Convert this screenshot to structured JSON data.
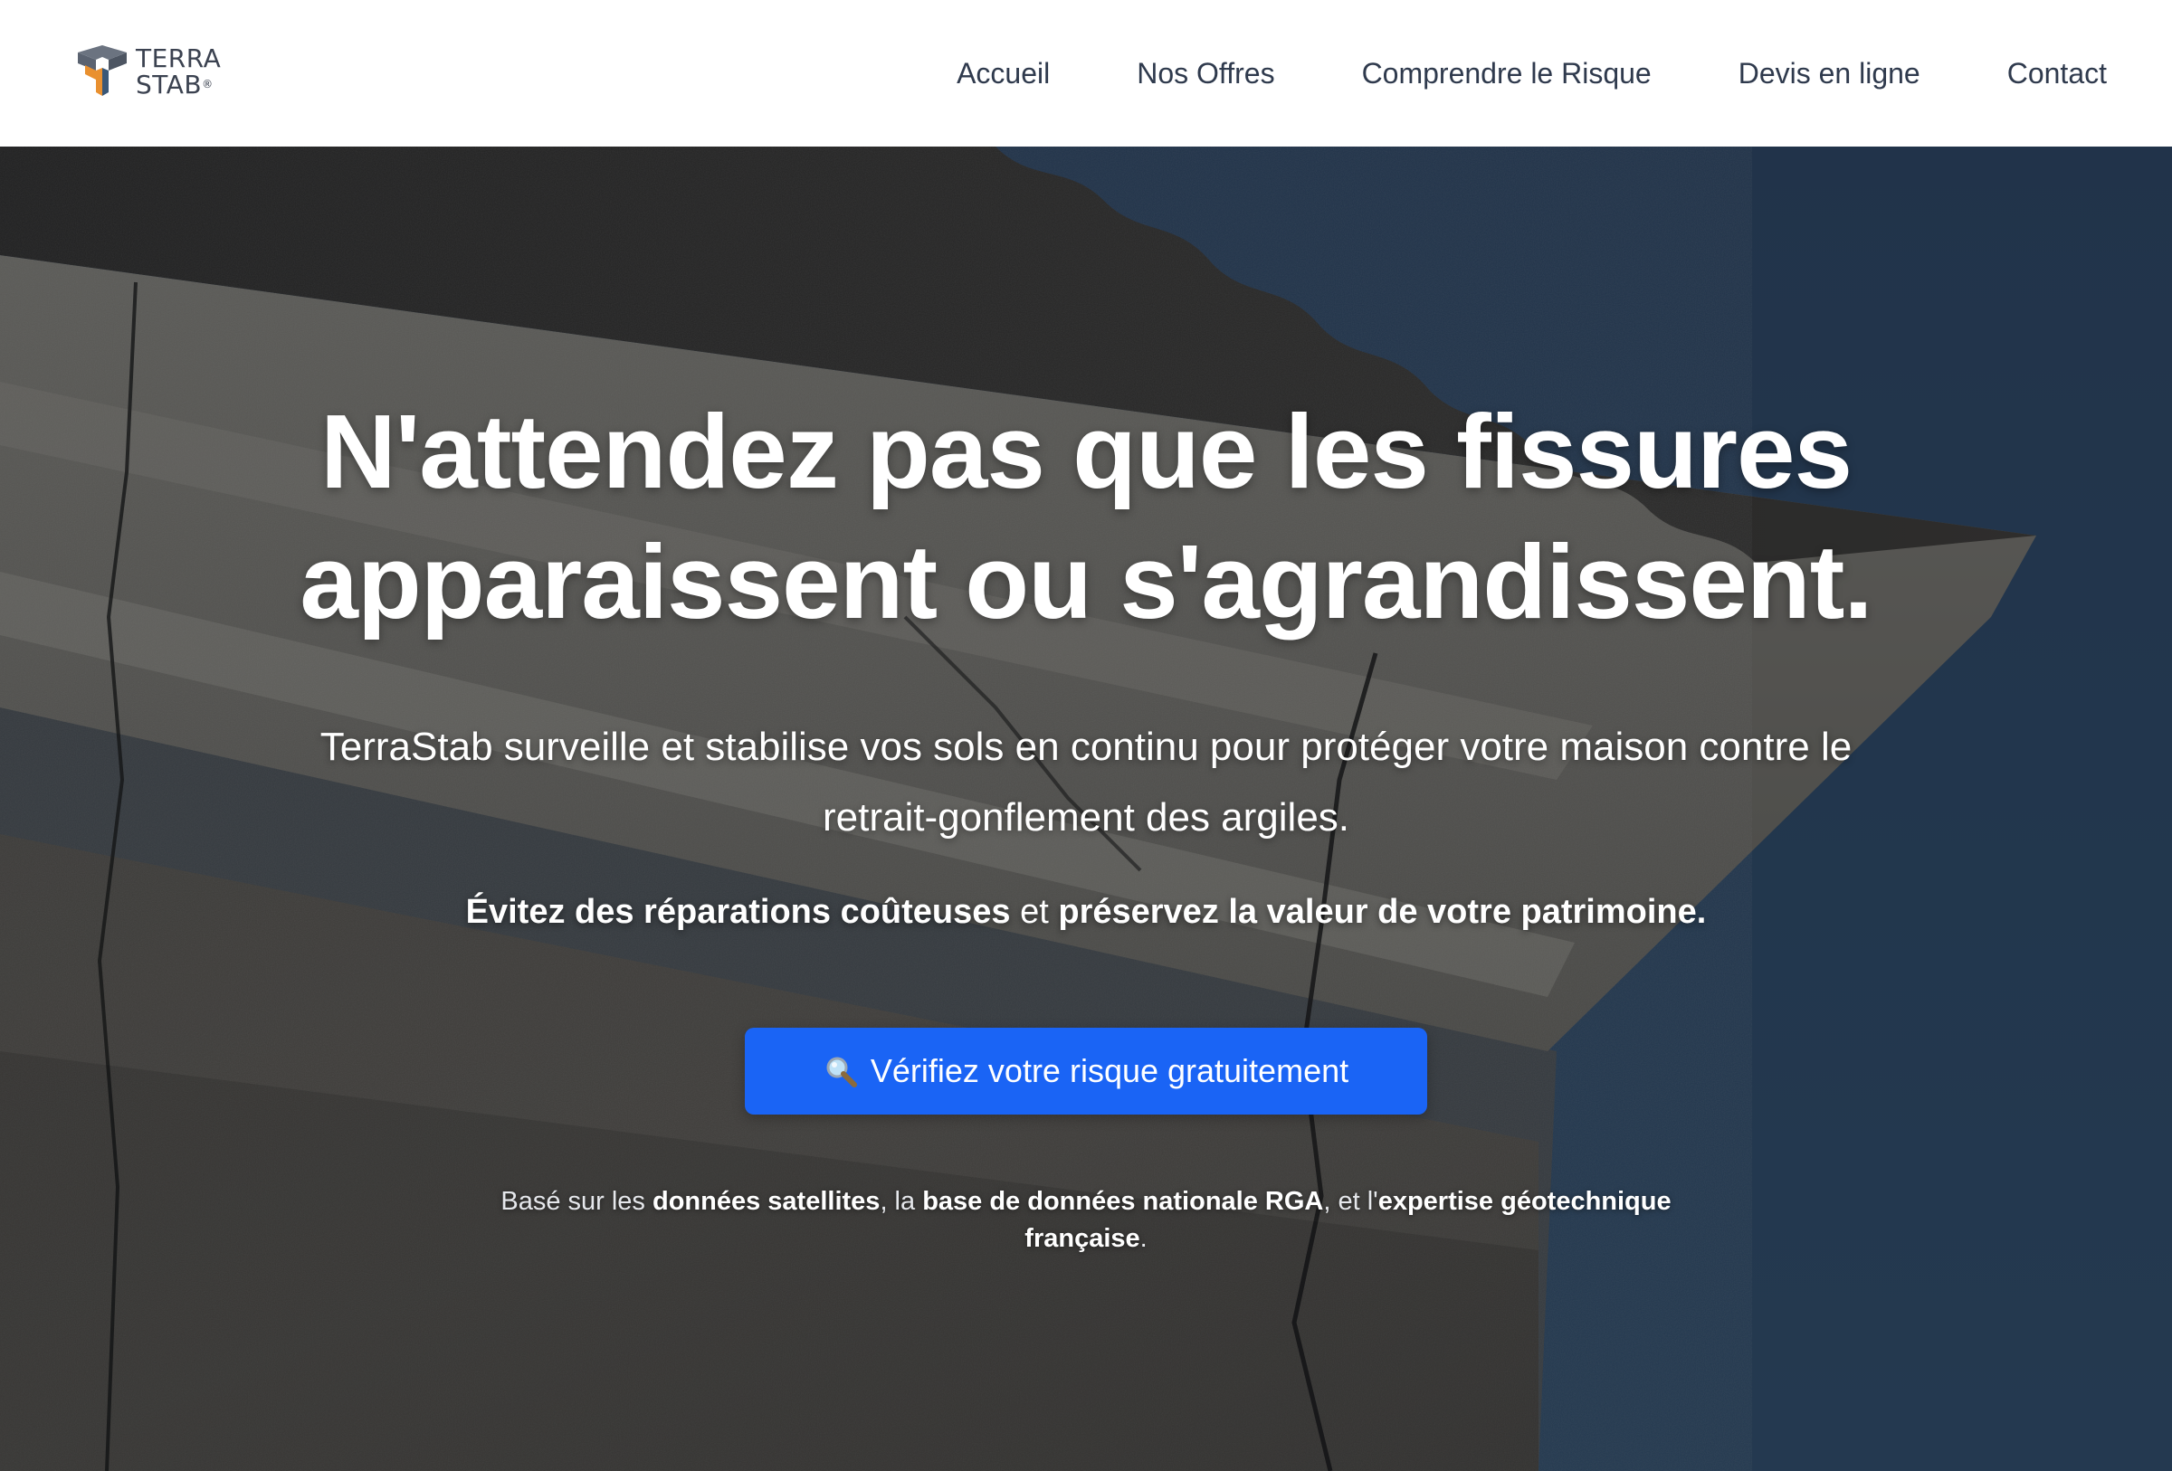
{
  "header": {
    "logo": {
      "line1": "TERRA",
      "line2": "STAB",
      "mark": "®"
    },
    "nav": [
      {
        "label": "Accueil"
      },
      {
        "label": "Nos Offres"
      },
      {
        "label": "Comprendre le Risque"
      },
      {
        "label": "Devis en ligne"
      },
      {
        "label": "Contact"
      }
    ]
  },
  "hero": {
    "title_line1": "N'attendez pas que les fissures",
    "title_line2": "apparaissent ou s'agrandissent.",
    "subtitle": "TerraStab surveille et stabilise vos sols en continu pour protéger votre maison contre le retrait-gonflement des argiles.",
    "tagline": {
      "part1": "Évitez des réparations coûteuses",
      "part2": " et ",
      "part3": "préservez la valeur de votre patrimoine."
    },
    "cta": {
      "icon": "search-icon",
      "label": "Vérifiez votre risque gratuitement"
    },
    "note": {
      "p1": "Basé sur les ",
      "b1": "données satellites",
      "p2": ", la ",
      "b2": "base de données nationale RGA",
      "p3": ", et l'",
      "b3": "expertise géotechnique française",
      "p4": "."
    }
  },
  "colors": {
    "cta_background": "#1a64f5",
    "nav_text": "#2f3a4d",
    "sky": "#2e4460",
    "logo_orange": "#e9902f",
    "logo_blue": "#3a5878",
    "logo_gray": "#5a6270"
  }
}
